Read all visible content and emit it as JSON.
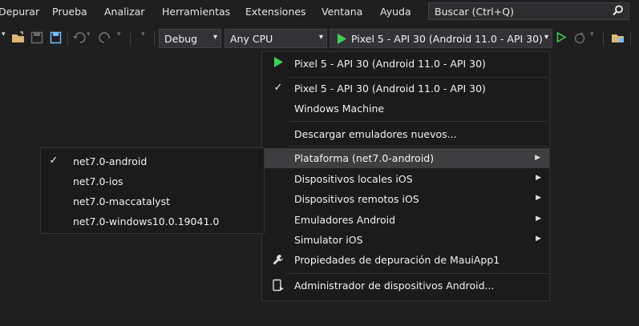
{
  "menubar": {
    "items": [
      "Depurar",
      "Prueba",
      "Analizar",
      "Herramientas",
      "Extensiones",
      "Ventana",
      "Ayuda"
    ],
    "search_placeholder": "Buscar (Ctrl+Q)"
  },
  "toolbar": {
    "config_label": "Debug",
    "platform_label": "Any CPU",
    "target_label": "Pixel 5 - API 30 (Android 11.0 - API 30)"
  },
  "dropdown": {
    "items": [
      {
        "label": "Pixel 5 - API 30 (Android 11.0 - API 30)",
        "icon": "play-icon"
      },
      {
        "label": "Pixel 5 - API 30 (Android 11.0 - API 30)",
        "icon": "checkmark"
      },
      {
        "label": "Windows Machine"
      },
      {
        "label": "Descargar emuladores nuevos..."
      },
      {
        "label": "Plataforma (net7.0-android)",
        "submenu": true
      },
      {
        "label": "Dispositivos locales iOS",
        "submenu": true
      },
      {
        "label": "Dispositivos remotos iOS",
        "submenu": true
      },
      {
        "label": "Emuladores Android",
        "submenu": true
      },
      {
        "label": "Simulator iOS",
        "submenu": true
      },
      {
        "label": "Propiedades de depuración de MauiApp1",
        "icon": "wrench-icon"
      },
      {
        "label": "Administrador de dispositivos Android...",
        "icon": "device-manager-icon"
      }
    ]
  },
  "submenu": {
    "items": [
      {
        "label": "net7.0-android",
        "checked": true
      },
      {
        "label": "net7.0-ios"
      },
      {
        "label": "net7.0-maccatalyst"
      },
      {
        "label": "net7.0-windows10.0.19041.0"
      }
    ]
  },
  "colors": {
    "background": "#1f1f1f",
    "menu_bg": "#1b1b1c",
    "highlight": "#3e3e40",
    "play_green": "#39d353",
    "folder_yellow": "#dcb67a",
    "save_blue": "#75beff"
  }
}
